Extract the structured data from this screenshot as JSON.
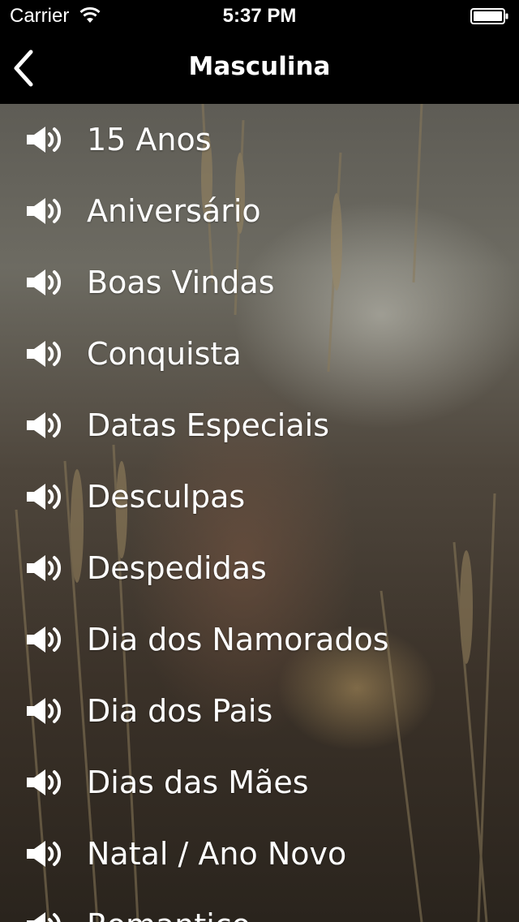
{
  "status_bar": {
    "carrier": "Carrier",
    "time": "5:37 PM"
  },
  "nav": {
    "title": "Masculina",
    "back_icon": "chevron-left-icon"
  },
  "list": {
    "item_icon": "speaker-icon",
    "items": [
      {
        "label": "15 Anos"
      },
      {
        "label": "Aniversário"
      },
      {
        "label": "Boas Vindas"
      },
      {
        "label": "Conquista"
      },
      {
        "label": "Datas Especiais"
      },
      {
        "label": "Desculpas"
      },
      {
        "label": "Despedidas"
      },
      {
        "label": "Dia dos Namorados"
      },
      {
        "label": "Dia dos Pais"
      },
      {
        "label": "Dias das Mães"
      },
      {
        "label": "Natal / Ano Novo"
      },
      {
        "label": "Romantico"
      }
    ]
  },
  "colors": {
    "bar_background": "#000000",
    "text": "#ffffff"
  }
}
